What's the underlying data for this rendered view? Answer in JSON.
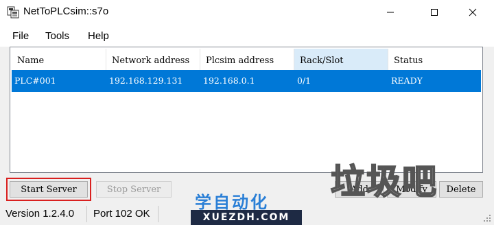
{
  "window": {
    "title": "NetToPLCsim::s7o"
  },
  "menu": {
    "items": [
      "File",
      "Tools",
      "Help"
    ]
  },
  "table": {
    "columns": [
      "Name",
      "Network address",
      "Plcsim address",
      "Rack/Slot",
      "Status"
    ],
    "rows": [
      [
        "PLC#001",
        "192.168.129.131",
        "192.168.0.1",
        "0/1",
        "READY"
      ]
    ]
  },
  "buttons": {
    "start_server": "Start Server",
    "stop_server": "Stop Server",
    "add": "Add",
    "modify": "Modify",
    "delete": "Delete"
  },
  "status": {
    "version": "Version 1.2.4.0",
    "port": "Port 102 OK"
  },
  "watermark": {
    "top": "垃圾吧",
    "cn": "学自动化",
    "url": "XUEZDH.COM"
  },
  "colors": {
    "selection": "#0078d7",
    "header_selected": "#d9ebf9",
    "focus_outline": "#d9201f"
  }
}
